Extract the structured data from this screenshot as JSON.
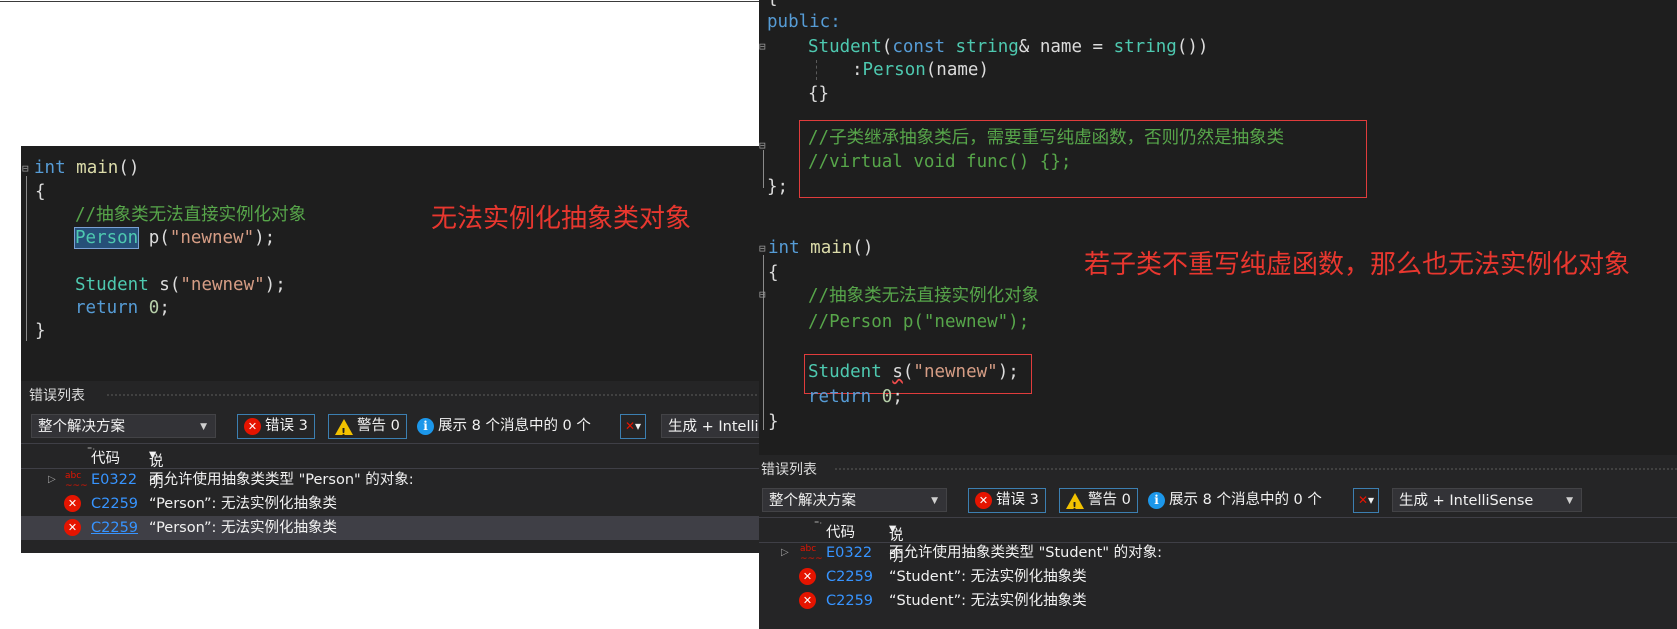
{
  "left": {
    "code": {
      "main_sig": {
        "kw": "int",
        "fn": "main",
        "rest": "()"
      },
      "open_brace": "{",
      "comment": "//抽象类无法直接实例化对象",
      "person_line": {
        "type": "Person",
        "ident": " p(",
        "str": "\"newnew\"",
        "end": ");"
      },
      "student_line": {
        "type": "Student",
        "ident": " s(",
        "str": "\"newnew\"",
        "end": ");"
      },
      "return_line": {
        "kw": "return",
        "num": "0",
        "end": ";"
      },
      "close_brace": "}"
    },
    "annotation": "无法实例化抽象类对象",
    "errlist": {
      "title": "错误列表",
      "scope": "整个解决方案",
      "errors_label": "错误 3",
      "warnings_label": "警告 0",
      "messages_label": "展示 8 个消息中的 0 个",
      "build_label": "生成 + IntelliSense",
      "col_code": "代码",
      "col_desc": "说明",
      "rows": [
        {
          "code": "E0322",
          "desc": "不允许使用抽象类类型 \"Person\" 的对象:"
        },
        {
          "code": "C2259",
          "desc": "“Person”: 无法实例化抽象类"
        },
        {
          "code": "C2259",
          "desc": "“Person”: 无法实例化抽象类"
        }
      ]
    }
  },
  "right": {
    "code": {
      "top_brace": "{",
      "public": "public:",
      "ctor": {
        "type": "Student",
        "p1": "(",
        "kw": "const",
        "t2": "string",
        "p2": "& name = ",
        "t3": "string",
        "p3": "())"
      },
      "init": {
        "p": ":",
        "type": "Person",
        "rest": "(name)"
      },
      "body": "{}",
      "comment1": "//子类继承抽象类后，需要重写纯虚函数，否则仍然是抽象类",
      "comment2": "//virtual void func() {};",
      "class_end": "};",
      "main_sig": {
        "kw": "int",
        "fn": "main",
        "rest": "()"
      },
      "open_brace": "{",
      "comment3": "//抽象类无法直接实例化对象",
      "comment4": "//Person p(\"newnew\");",
      "student_line": {
        "type": "Student",
        "pre": " ",
        "ident": "s",
        "open": "(",
        "str": "\"newnew\"",
        "end": ");"
      },
      "return_line": {
        "kw": "return",
        "num": "0",
        "end": ";"
      },
      "close_brace": "}"
    },
    "annotation": "若子类不重写纯虚函数，那么也无法实例化对象",
    "errlist": {
      "title": "错误列表",
      "scope": "整个解决方案",
      "errors_label": "错误 3",
      "warnings_label": "警告 0",
      "messages_label": "展示 8 个消息中的 0 个",
      "build_label": "生成 + IntelliSense",
      "col_code": "代码",
      "col_desc": "说明",
      "rows": [
        {
          "code": "E0322",
          "desc": "不允许使用抽象类类型 \"Student\" 的对象:"
        },
        {
          "code": "C2259",
          "desc": "“Student”: 无法实例化抽象类"
        },
        {
          "code": "C2259",
          "desc": "“Student”: 无法实例化抽象类"
        }
      ]
    }
  },
  "icons": {
    "error": "error-circle-icon",
    "warning": "warning-triangle-icon",
    "info": "info-circle-icon",
    "filter": "filter-icon",
    "expand": "expand-triangle-icon",
    "spell": "abc-spell-icon"
  },
  "colors": {
    "editor_bg": "#1e1e1e",
    "keyword": "#569cd6",
    "type": "#4ec9b0",
    "comment": "#57a64a",
    "string": "#d69d85",
    "annotation": "#e8372f"
  }
}
